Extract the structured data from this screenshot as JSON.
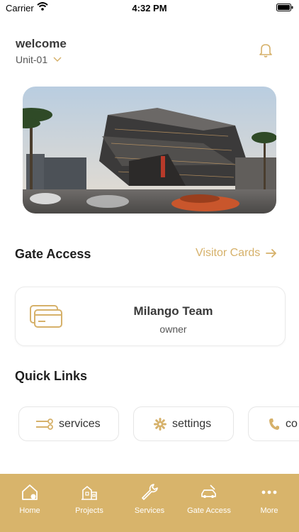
{
  "status": {
    "carrier": "Carrier",
    "time": "4:32 PM"
  },
  "header": {
    "welcome": "welcome",
    "unit": "Unit-01",
    "icons": [
      "chevron-down-icon",
      "bell-icon"
    ]
  },
  "gate_access": {
    "title": "Gate Access",
    "visitor_cards_label": "Visitor Cards",
    "card": {
      "name": "Milango Team",
      "role": "owner",
      "icon": "card-icon"
    }
  },
  "quick_links": {
    "title": "Quick Links",
    "items": [
      {
        "label": "services",
        "icon": "tools-icon"
      },
      {
        "label": "settings",
        "icon": "gear-icon"
      },
      {
        "label": "co",
        "icon": "phone-icon"
      }
    ]
  },
  "bottom_nav": {
    "items": [
      {
        "label": "Home",
        "icon": "home-icon"
      },
      {
        "label": "Projects",
        "icon": "projects-icon"
      },
      {
        "label": "Services",
        "icon": "wrench-icon"
      },
      {
        "label": "Gate Access",
        "icon": "car-icon"
      },
      {
        "label": "More",
        "icon": "more-icon"
      }
    ]
  },
  "colors": {
    "accent": "#d8b46b",
    "accent_text": "#d6b16a",
    "nav_bg": "#d8b46b"
  }
}
